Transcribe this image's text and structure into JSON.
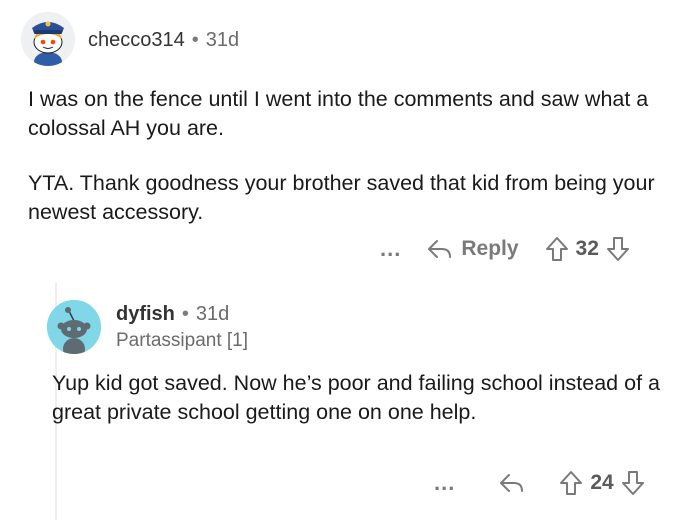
{
  "comments": [
    {
      "username": "checco314",
      "age": "31d",
      "paragraphs": [
        "I was on the fence until I went into the comments and saw what a colossal AH you are.",
        "YTA. Thank goodness your brother saved that kid from being your newest accessory."
      ],
      "actions": {
        "more": "...",
        "reply_label": "Reply",
        "score": "32"
      }
    },
    {
      "username": "dyfish",
      "age": "31d",
      "flair": "Partassipant [1]",
      "paragraphs": [
        "Yup kid got saved. Now he’s poor and failing school instead of a great private school getting one on one help."
      ],
      "actions": {
        "more": "...",
        "score": "24"
      }
    }
  ],
  "separator": "•",
  "colors": {
    "muted": "#7a7a7a",
    "avatar2_bg": "#7fd7e8",
    "thread_line": "#edeff1"
  }
}
